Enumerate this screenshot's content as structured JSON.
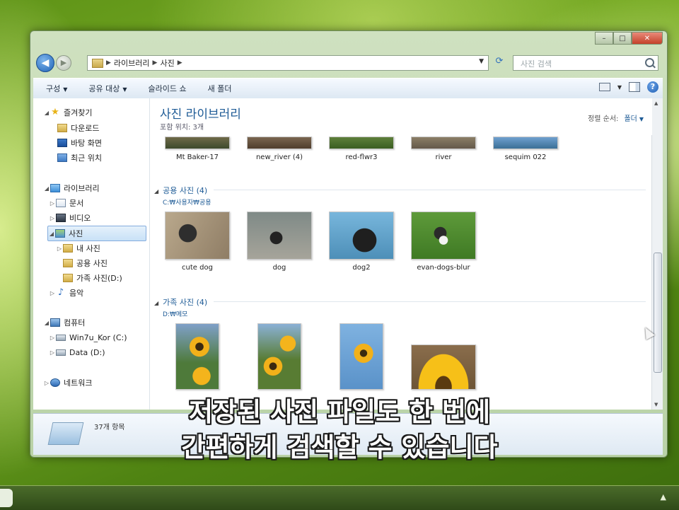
{
  "address": {
    "parts": [
      "라이브러리",
      "사진"
    ]
  },
  "search": {
    "placeholder": "사진 검색"
  },
  "toolbar": {
    "organize": "구성",
    "share": "공유 대상",
    "slideshow": "슬라이드 쇼",
    "new_folder": "새 폴더"
  },
  "nav": {
    "favorites": "즐겨찾기",
    "downloads": "다운로드",
    "desktop": "바탕 화면",
    "recent": "최근 위치",
    "libraries": "라이브러리",
    "documents": "문서",
    "videos": "비디오",
    "pictures": "사진",
    "my_pictures": "내 사진",
    "public_pictures": "공용 사진",
    "family_pictures": "가족 사진(D:)",
    "music": "음악",
    "computer": "컴퓨터",
    "drive_c": "Win7u_Kor (C:)",
    "drive_d": "Data (D:)",
    "network": "네트워크"
  },
  "library": {
    "title": "사진 라이브러리",
    "subtitle": "포함 위치: 3개",
    "sort_label": "정렬 순서:",
    "sort_value": "폴더"
  },
  "top_row": [
    "Mt Baker-17",
    "new_river (4)",
    "red-flwr3",
    "river",
    "sequim 022"
  ],
  "groups": {
    "public": {
      "title": "공용 사진 (4)",
      "path": "C:₩사용자₩공용",
      "items": [
        "cute dog",
        "dog",
        "dog2",
        "evan-dogs-blur"
      ]
    },
    "family": {
      "title": "가족 사진 (4)",
      "path": "D:₩메모"
    }
  },
  "details": {
    "count": "37개 항목"
  },
  "subtitles": {
    "line1": "저장된 사진 파일도 한 번에",
    "line2": "간편하게 검색할 수 있습니다"
  },
  "colors": {
    "accent": "#1e5b96",
    "selection": "#c8e1f7"
  }
}
